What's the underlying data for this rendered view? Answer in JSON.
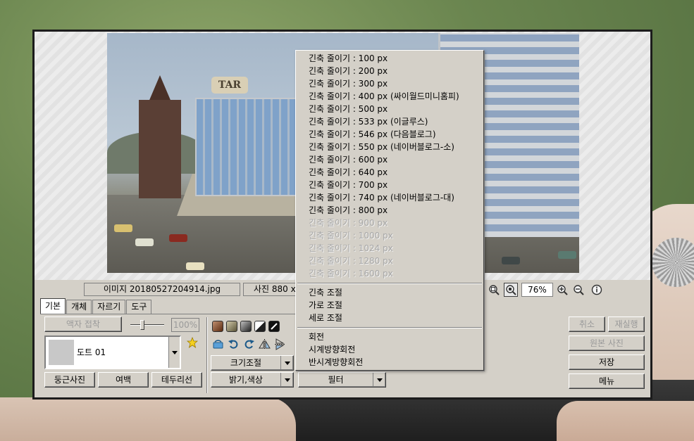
{
  "status": {
    "file_name": "이미지 20180527204914.jpg",
    "photo_size": "사진 880 x",
    "zoom_level": "76%"
  },
  "tabs": [
    {
      "label": "기본",
      "active": true
    },
    {
      "label": "개체",
      "active": false
    },
    {
      "label": "자르기",
      "active": false
    },
    {
      "label": "도구",
      "active": false
    }
  ],
  "left_panel": {
    "frame_attach_label": "액자 접착",
    "opacity_value": "100%",
    "frame_name": "도트 01",
    "round_photo_label": "둥근사진",
    "margin_label": "여백",
    "border_line_label": "테두리선"
  },
  "middle_panel": {
    "resize_label": "크기조절",
    "brightness_label": "밝기,색상",
    "filter_label": "필터"
  },
  "right_panel": {
    "undo_label": "취소",
    "redo_label": "재실행",
    "original_label": "원본 사진",
    "save_label": "저장",
    "menu_label": "메뉴"
  },
  "context_menu": {
    "shrink_items": [
      {
        "label": "긴축 줄이기 : 100 px",
        "enabled": true
      },
      {
        "label": "긴축 줄이기 : 200 px",
        "enabled": true
      },
      {
        "label": "긴축 줄이기 : 300 px",
        "enabled": true
      },
      {
        "label": "긴축 줄이기 : 400 px (싸이월드미니홈피)",
        "enabled": true
      },
      {
        "label": "긴축 줄이기 : 500 px",
        "enabled": true
      },
      {
        "label": "긴축 줄이기 : 533 px (이글루스)",
        "enabled": true
      },
      {
        "label": "긴축 줄이기 : 546 px (다음블로그)",
        "enabled": true
      },
      {
        "label": "긴축 줄이기 : 550 px (네이버블로그-소)",
        "enabled": true
      },
      {
        "label": "긴축 줄이기 : 600 px",
        "enabled": true
      },
      {
        "label": "긴축 줄이기 : 640 px",
        "enabled": true
      },
      {
        "label": "긴축 줄이기 : 700 px",
        "enabled": true
      },
      {
        "label": "긴축 줄이기 : 740 px (네이버블로그-대)",
        "enabled": true
      },
      {
        "label": "긴축 줄이기 : 800 px",
        "enabled": true
      },
      {
        "label": "긴축 줄이기 : 900 px",
        "enabled": false
      },
      {
        "label": "긴축 줄이기 : 1000 px",
        "enabled": false
      },
      {
        "label": "긴축 줄이기 : 1024 px",
        "enabled": false
      },
      {
        "label": "긴축 줄이기 : 1280 px",
        "enabled": false
      },
      {
        "label": "긴축 줄이기 : 1600 px",
        "enabled": false
      }
    ],
    "adjust_items": [
      {
        "label": "긴축 조절",
        "enabled": true
      },
      {
        "label": "가로 조절",
        "enabled": true
      },
      {
        "label": "세로 조절",
        "enabled": true
      }
    ],
    "rotate_items": [
      {
        "label": "회전",
        "enabled": true
      },
      {
        "label": "시계방향회전",
        "enabled": true
      },
      {
        "label": "반시계방향회전",
        "enabled": true
      }
    ]
  },
  "photo": {
    "sign_text": "TAR"
  },
  "icons": {
    "zoom": [
      "zoom-fit-icon",
      "zoom-actual-icon",
      "zoom-in-icon",
      "zoom-out-icon",
      "info-icon"
    ],
    "tools": [
      "flip-icon",
      "undo-rotate-icon",
      "redo-rotate-icon",
      "mirror-horizontal-icon",
      "mirror-vertical-icon"
    ],
    "star": "star-icon"
  },
  "colors": {
    "window_bg": "#d4d0c8",
    "disabled_text": "#a8a8a8",
    "chips": [
      "#7a4a2a",
      "#8a8060",
      "#555555",
      "#777777",
      "#111111"
    ]
  }
}
